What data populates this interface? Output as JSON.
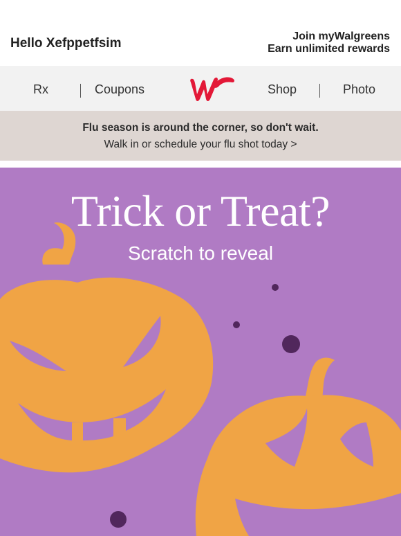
{
  "header": {
    "greeting": "Hello Xefppetfsim",
    "join_line1": "Join myWalgreens",
    "join_line2": "Earn unlimited rewards"
  },
  "nav": {
    "items": [
      {
        "label": "Rx"
      },
      {
        "label": "Coupons"
      },
      {
        "label": "Shop"
      },
      {
        "label": "Photo"
      }
    ],
    "logo_icon": "walgreens-w-logo-icon"
  },
  "banner": {
    "headline": "Flu season is around the corner, so don't wait.",
    "cta": "Walk in or schedule your flu shot today >"
  },
  "hero": {
    "title": "Trick or Treat?",
    "subtitle": "Scratch to reveal"
  },
  "colors": {
    "brand_red": "#e31837",
    "hero_purple": "#b07bc4",
    "pumpkin_orange": "#f0a445",
    "dot_purple": "#51275c"
  }
}
